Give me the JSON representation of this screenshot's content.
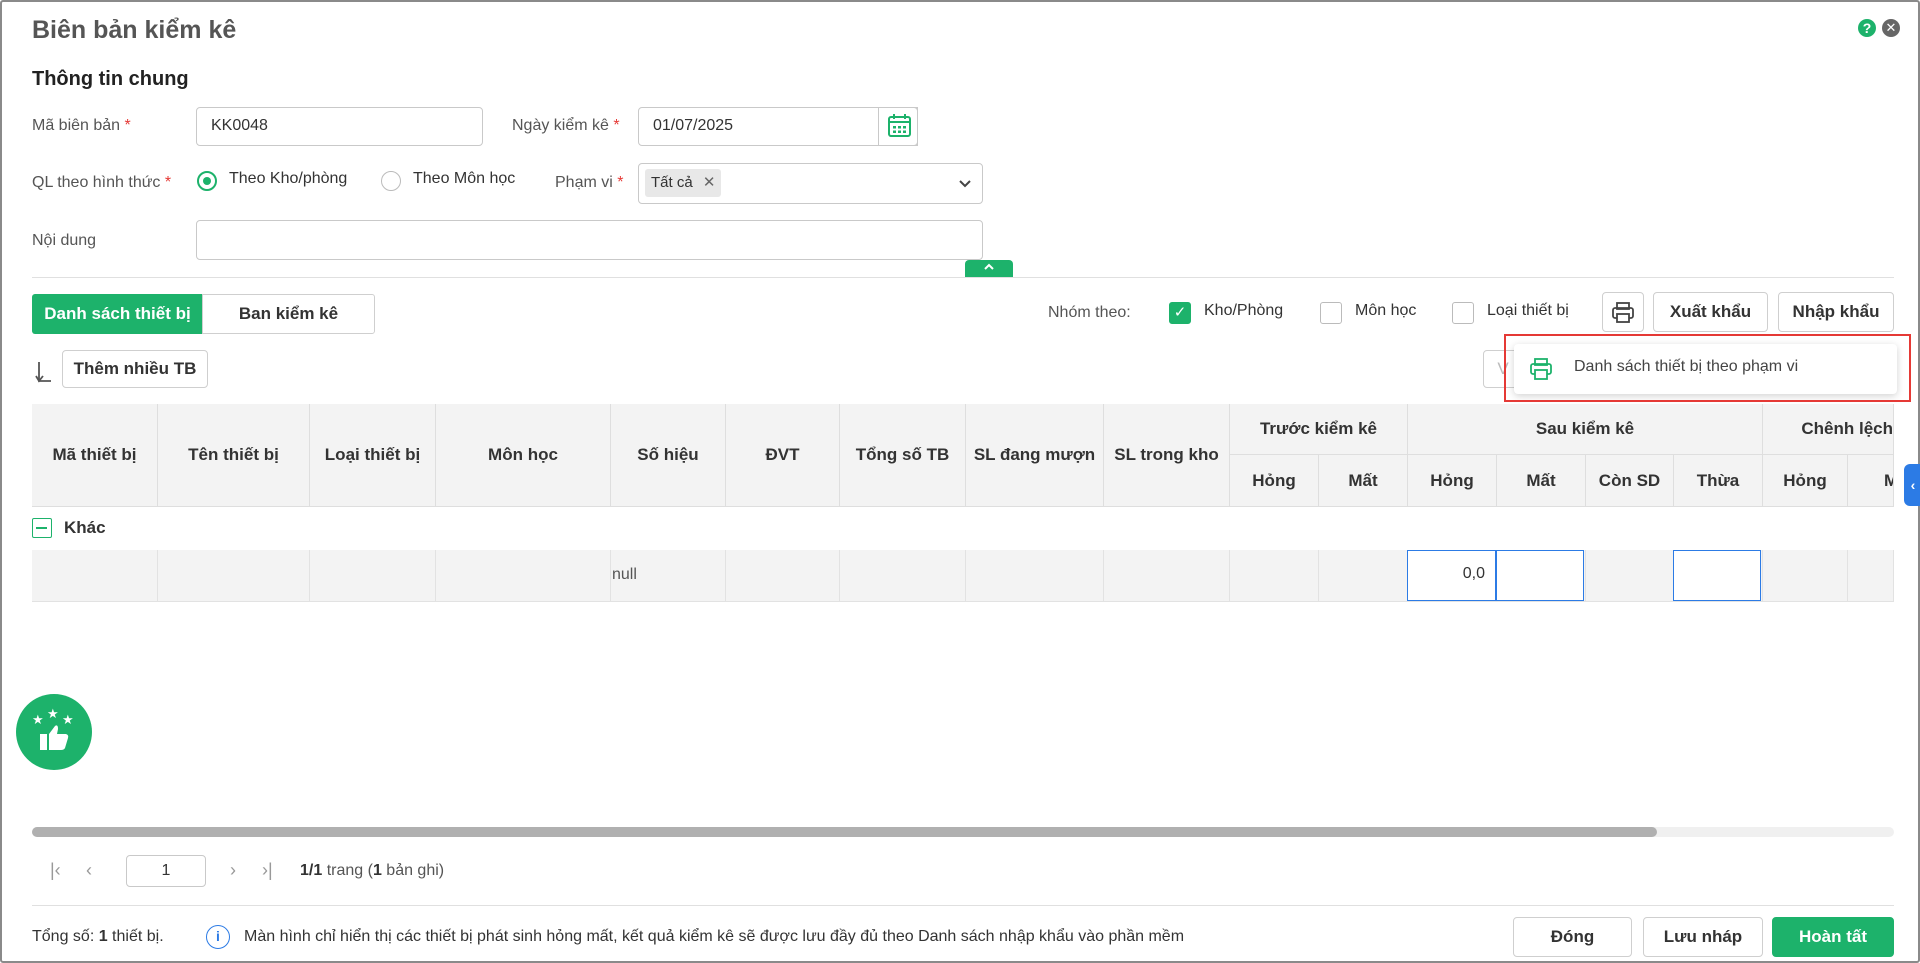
{
  "dialog": {
    "title": "Biên bản kiểm kê"
  },
  "general": {
    "section_title": "Thông tin chung",
    "code_label": "Mã biên bản",
    "code_value": "KK0048",
    "date_label": "Ngày kiểm kê",
    "date_value": "01/07/2025",
    "manage_label": "QL theo hình thức",
    "radio_room": "Theo Kho/phòng",
    "radio_subject": "Theo Môn học",
    "scope_label": "Phạm vi",
    "scope_chip": "Tất cả",
    "content_label": "Nội dung",
    "required_mark": "*"
  },
  "tabs": {
    "active": "Danh sách thiết bị",
    "inactive": "Ban kiểm kê"
  },
  "group": {
    "label": "Nhóm theo:",
    "opt_room": "Kho/Phòng",
    "opt_subject": "Môn học",
    "opt_type": "Loại thiết bị"
  },
  "toolbar": {
    "export": "Xuất khẩu",
    "import": "Nhập khẩu",
    "add_many": "Thêm nhiều TB",
    "print_menu_item": "Danh sách thiết bị theo phạm vi",
    "hidden_btn_text": "V"
  },
  "table": {
    "columns": {
      "code": "Mã thiết bị",
      "name": "Tên thiết bị",
      "type": "Loại thiết bị",
      "subject": "Môn học",
      "serial": "Số hiệu",
      "unit": "ĐVT",
      "total": "Tổng số TB",
      "borrowed": "SL đang mượn",
      "in_stock": "SL trong kho",
      "before": "Trước kiểm kê",
      "after": "Sau kiểm kê",
      "diff": "Chênh lệch",
      "broken": "Hỏng",
      "lost": "Mất",
      "in_use": "Còn SD",
      "surplus": "Thừa",
      "m_cut": "M"
    },
    "group_name": "Khác",
    "row": {
      "serial": "null",
      "after_broken": "0,0"
    }
  },
  "pagination": {
    "page_input": "1",
    "page_info_bold": "1/1",
    "page_info_mid": " trang (",
    "records_bold": "1",
    "records_tail": " bản ghi)"
  },
  "footer": {
    "total_prefix": "Tổng số: ",
    "total_count": "1",
    "total_suffix": " thiết bị.",
    "info_note": "Màn hình chỉ hiển thị các thiết bị phát sinh hỏng mất, kết quả kiểm kê sẽ được lưu đầy đủ theo Danh sách nhập khẩu vào phần mềm",
    "close": "Đóng",
    "save_draft": "Lưu nháp",
    "finish": "Hoàn tất"
  },
  "colors": {
    "accent": "#1db26b",
    "required": "#e53935",
    "focus": "#2c7be5",
    "highlight": "#e53935"
  }
}
